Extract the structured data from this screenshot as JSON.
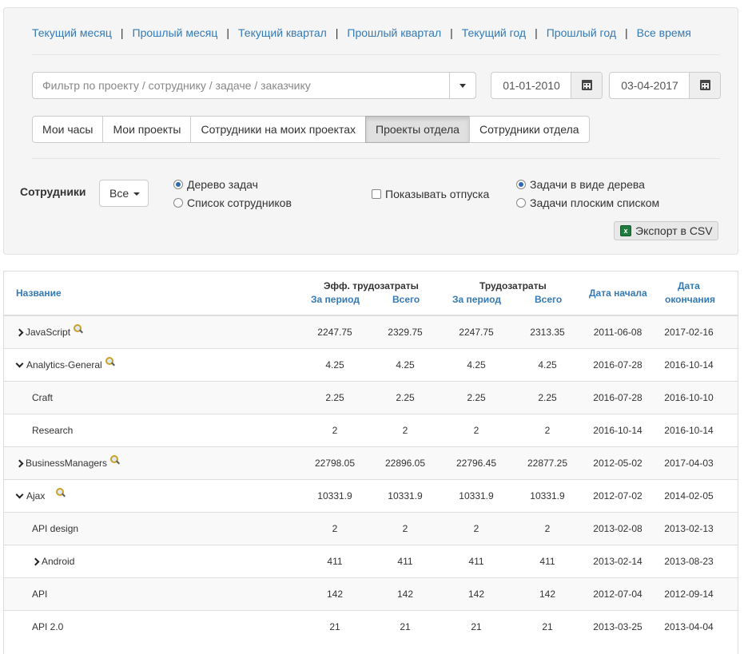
{
  "period_links": [
    "Текущий месяц",
    "Прошлый месяц",
    "Текущий квартал",
    "Прошлый квартал",
    "Текущий год",
    "Прошлый год",
    "Все время"
  ],
  "period_separator": "|",
  "filter": {
    "placeholder": "Фильтр по проекту / сотруднику / задаче / заказчику"
  },
  "date_from": "01-01-2010",
  "date_to": "03-04-2017",
  "view_tabs": [
    "Мои часы",
    "Мои проекты",
    "Сотрудники на моих проектах",
    "Проекты отдела",
    "Сотрудники отдела"
  ],
  "active_view_tab": "Проекты отдела",
  "employees": {
    "label": "Сотрудники",
    "dropdown_value": "Все"
  },
  "grouping_options": [
    {
      "label": "Дерево задач",
      "checked": true
    },
    {
      "label": "Список сотрудников",
      "checked": false
    }
  ],
  "show_vacations": {
    "label": "Показывать отпуска",
    "checked": false
  },
  "task_view_options": [
    {
      "label": "Задачи в виде дерева",
      "checked": true
    },
    {
      "label": "Задачи плоским списком",
      "checked": false
    }
  ],
  "export_label": "Экспорт в CSV",
  "table": {
    "headers": {
      "name": "Название",
      "eff_group": "Эфф. трудозатраты",
      "labor_group": "Трудозатраты",
      "for_period": "За период",
      "total": "Всего",
      "start_date": "Дата начала",
      "end_date_line1": "Дата",
      "end_date_line2": "окончания"
    },
    "rows": [
      {
        "name": "JavaScript",
        "icon": "chevron-right",
        "search": true,
        "indent": 0,
        "eff_period": "2247.75",
        "eff_total": "2329.75",
        "labor_period": "2247.75",
        "labor_total": "2313.35",
        "start": "2011-06-08",
        "end": "2017-02-16"
      },
      {
        "name": "Analytics-General",
        "icon": "chevron-down",
        "search": true,
        "indent": 0,
        "eff_period": "4.25",
        "eff_total": "4.25",
        "labor_period": "4.25",
        "labor_total": "4.25",
        "start": "2016-07-28",
        "end": "2016-10-14"
      },
      {
        "name": "Craft",
        "icon": "",
        "search": false,
        "indent": 1,
        "eff_period": "2.25",
        "eff_total": "2.25",
        "labor_period": "2.25",
        "labor_total": "2.25",
        "start": "2016-07-28",
        "end": "2016-10-10"
      },
      {
        "name": "Research",
        "icon": "",
        "search": false,
        "indent": 1,
        "eff_period": "2",
        "eff_total": "2",
        "labor_period": "2",
        "labor_total": "2",
        "start": "2016-10-14",
        "end": "2016-10-14"
      },
      {
        "name": "BusinessManagers",
        "icon": "chevron-right",
        "search": true,
        "indent": 0,
        "eff_period": "22798.05",
        "eff_total": "22896.05",
        "labor_period": "22796.45",
        "labor_total": "22877.25",
        "start": "2012-05-02",
        "end": "2017-04-03"
      },
      {
        "name": "Ajax",
        "icon": "chevron-down",
        "search": true,
        "indent": 0,
        "eff_period": "10331.9",
        "eff_total": "10331.9",
        "labor_period": "10331.9",
        "labor_total": "10331.9",
        "start": "2012-07-02",
        "end": "2014-02-05"
      },
      {
        "name": "API design",
        "icon": "",
        "search": false,
        "indent": 1,
        "eff_period": "2",
        "eff_total": "2",
        "labor_period": "2",
        "labor_total": "2",
        "start": "2013-02-08",
        "end": "2013-02-13"
      },
      {
        "name": "Android",
        "icon": "chevron-right",
        "search": false,
        "indent": 1,
        "eff_period": "411",
        "eff_total": "411",
        "labor_period": "411",
        "labor_total": "411",
        "start": "2013-02-14",
        "end": "2013-08-23"
      },
      {
        "name": "API",
        "icon": "",
        "search": false,
        "indent": 1,
        "eff_period": "142",
        "eff_total": "142",
        "labor_period": "142",
        "labor_total": "142",
        "start": "2012-07-04",
        "end": "2012-09-14"
      },
      {
        "name": "API 2.0",
        "icon": "",
        "search": false,
        "indent": 1,
        "eff_period": "21",
        "eff_total": "21",
        "labor_period": "21",
        "labor_total": "21",
        "start": "2013-03-25",
        "end": "2013-04-04"
      }
    ]
  },
  "colors": {
    "link": "#337ab7",
    "panel_bg": "#f5f5f5",
    "row_stripe": "#f9f9f9",
    "radio_checked": "#2d6ab4"
  }
}
